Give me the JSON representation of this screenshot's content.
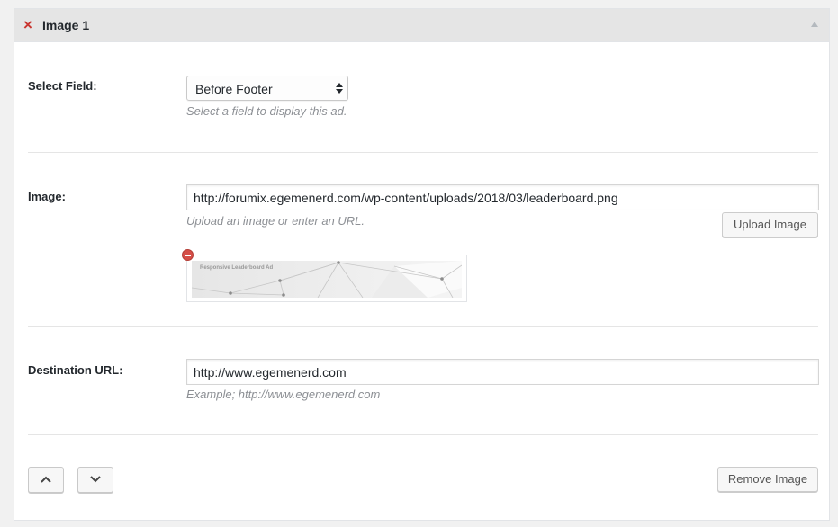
{
  "header": {
    "title": "Image 1",
    "close_glyph": "×"
  },
  "select_field": {
    "label": "Select Field:",
    "value": "Before Footer",
    "description": "Select a field to display this ad."
  },
  "image": {
    "label": "Image:",
    "url": "http://forumix.egemenerd.com/wp-content/uploads/2018/03/leaderboard.png",
    "description": "Upload an image or enter an URL.",
    "upload_button": "Upload Image",
    "thumbnail_text": "Responsive Leaderboard Ad"
  },
  "destination": {
    "label": "Destination URL:",
    "url": "http://www.egemenerd.com",
    "description": "Example; http://www.egemenerd.com"
  },
  "footer": {
    "remove_button": "Remove Image"
  },
  "colors": {
    "accent_red": "#c9352f",
    "header_bg": "#e5e5e5"
  }
}
